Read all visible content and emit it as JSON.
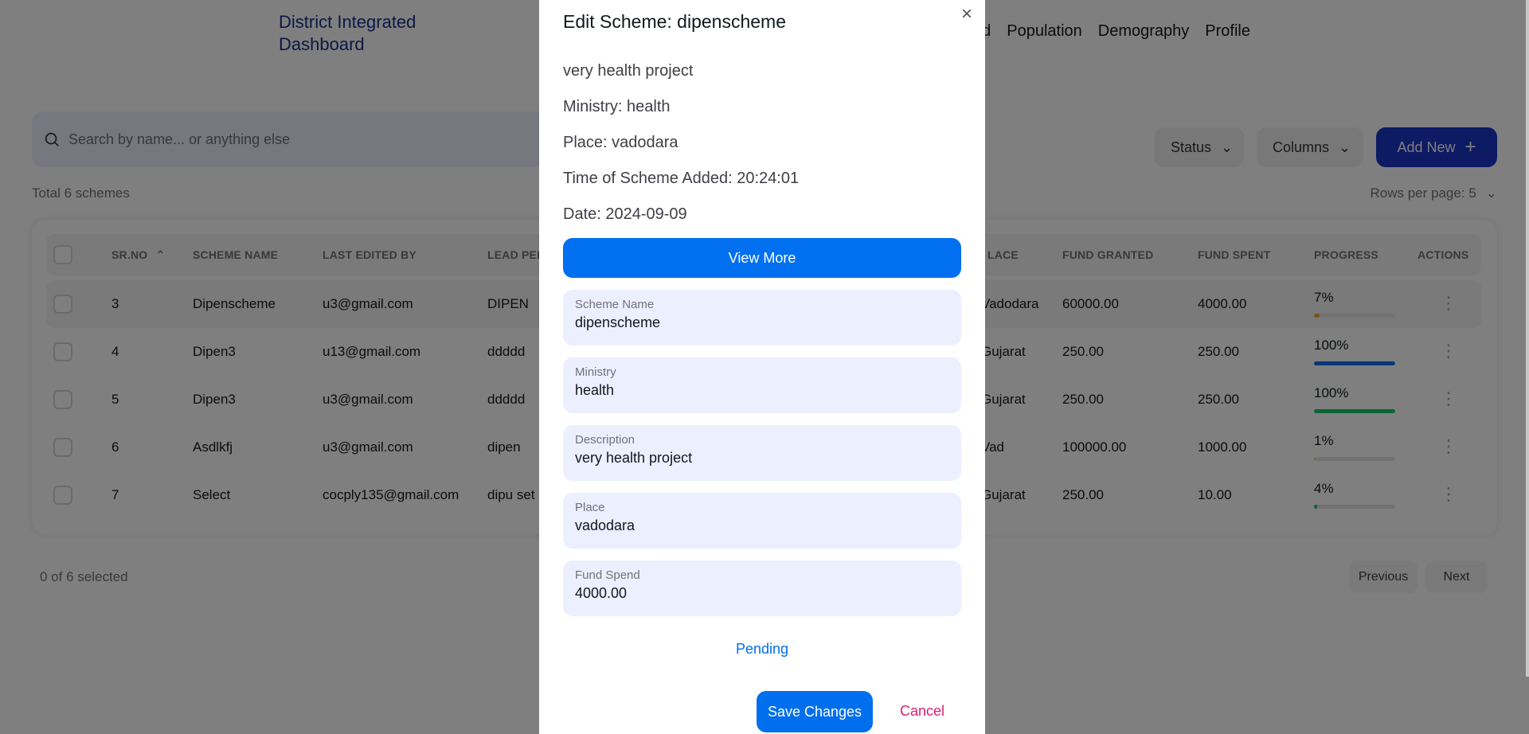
{
  "brand": {
    "line1": "District Integrated",
    "line2": "Dashboard"
  },
  "nav": {
    "items": [
      "d",
      "Population",
      "Demography",
      "Profile"
    ]
  },
  "toolbar": {
    "search_placeholder": "Search by name... or anything else",
    "status_label": "Status",
    "columns_label": "Columns",
    "add_new_label": "Add New"
  },
  "summary": {
    "total": "Total 6 schemes",
    "rows_per_page": "Rows per page: 5"
  },
  "table": {
    "headers": {
      "srno": "SR.NO",
      "scheme_name": "SCHEME NAME",
      "last_edited": "LAST EDITED BY",
      "lead_person": "LEAD PER",
      "place": "LACE",
      "fund_granted": "FUND GRANTED",
      "fund_spent": "FUND SPENT",
      "progress": "PROGRESS",
      "actions": "ACTIONS"
    },
    "rows": [
      {
        "srno": "3",
        "name": "Dipenscheme",
        "email": "u3@gmail.com",
        "lead": "DIPEN",
        "place": "Vadodara",
        "granted": "60000.00",
        "spent": "4000.00",
        "progress": "7%",
        "progress_value": 7,
        "bar_color": "#f5a524"
      },
      {
        "srno": "4",
        "name": "Dipen3",
        "email": "u13@gmail.com",
        "lead": "ddddd",
        "place": "Gujarat",
        "granted": "250.00",
        "spent": "250.00",
        "progress": "100%",
        "progress_value": 100,
        "bar_color": "#006fee"
      },
      {
        "srno": "5",
        "name": "Dipen3",
        "email": "u3@gmail.com",
        "lead": "ddddd",
        "place": "Gujarat",
        "granted": "250.00",
        "spent": "250.00",
        "progress": "100%",
        "progress_value": 100,
        "bar_color": "#17c964"
      },
      {
        "srno": "6",
        "name": "Asdlkfj",
        "email": "u3@gmail.com",
        "lead": "dipen",
        "place": "Vad",
        "granted": "100000.00",
        "spent": "1000.00",
        "progress": "1%",
        "progress_value": 1,
        "bar_color": "#f5a524"
      },
      {
        "srno": "7",
        "name": "Select",
        "email": "cocply135@gmail.com",
        "lead": "dipu set",
        "place": "Gujarat",
        "granted": "250.00",
        "spent": "10.00",
        "progress": "4%",
        "progress_value": 4,
        "bar_color": "#17c964"
      }
    ]
  },
  "footer": {
    "selected": "0 of 6 selected",
    "previous": "Previous",
    "next": "Next"
  },
  "modal": {
    "title": "Edit Scheme: dipenscheme",
    "description_text": "very health project",
    "ministry_text": "Ministry: health",
    "place_text": "Place: vadodara",
    "time_text": "Time of Scheme Added: 20:24:01",
    "date_text": "Date: 2024-09-09",
    "view_more": "View More",
    "fields": {
      "scheme_name": {
        "label": "Scheme Name",
        "value": "dipenscheme"
      },
      "ministry": {
        "label": "Ministry",
        "value": "health"
      },
      "description": {
        "label": "Description",
        "value": "very health project"
      },
      "place": {
        "label": "Place",
        "value": "vadodara"
      },
      "fund_spend": {
        "label": "Fund Spend",
        "value": "4000.00"
      }
    },
    "status": "Pending",
    "save": "Save Changes",
    "cancel": "Cancel"
  },
  "colors": {
    "primary": "#006fee",
    "brand": "#1b2f8a",
    "cancel": "#e11d74",
    "field_bg": "#eceffe"
  }
}
